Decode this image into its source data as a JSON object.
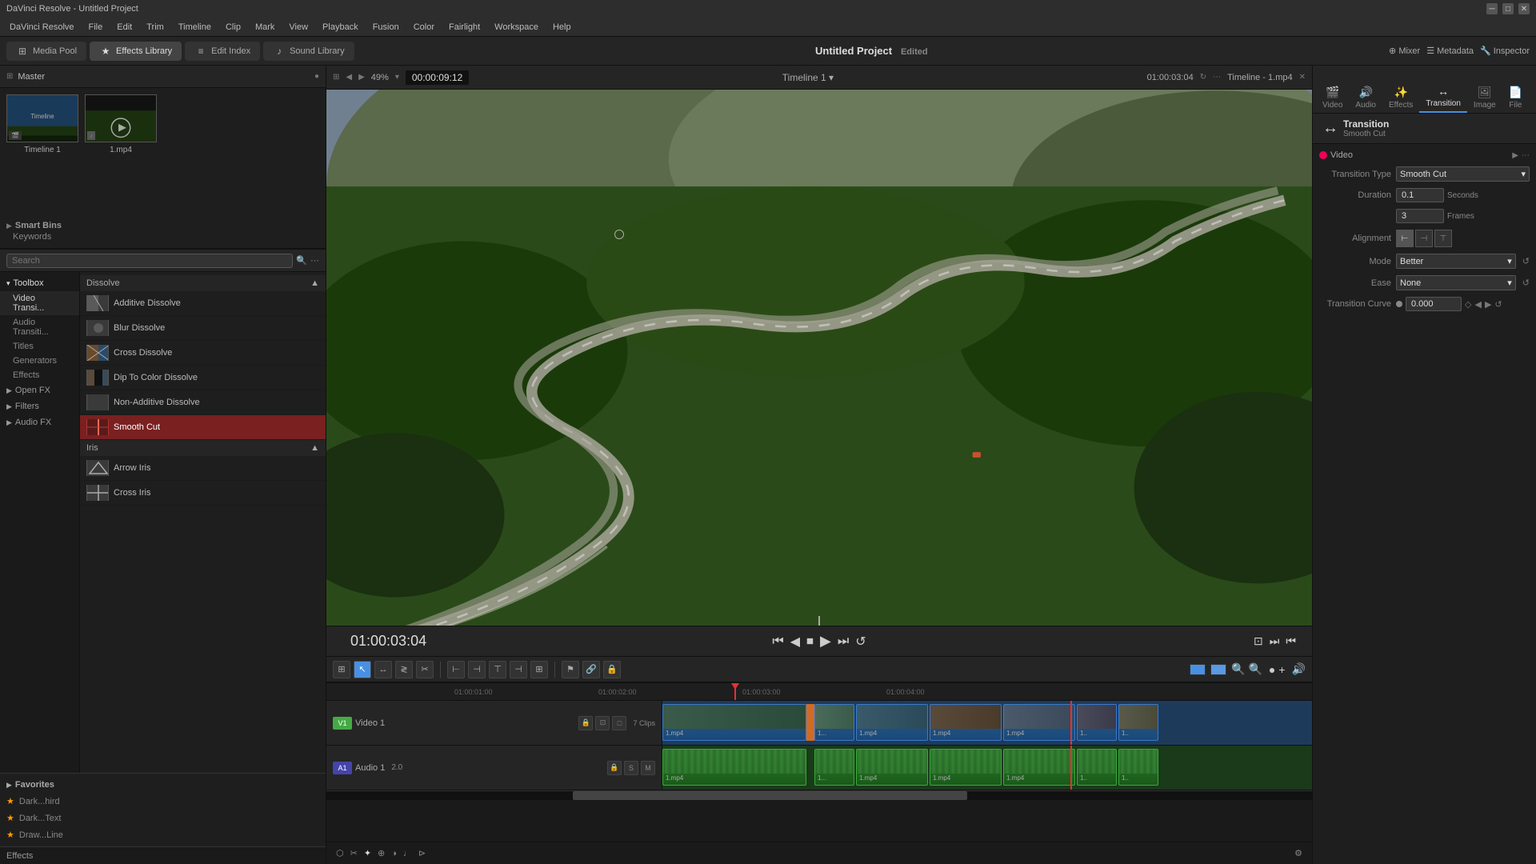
{
  "window": {
    "title": "DaVinci Resolve - Untitled Project"
  },
  "menubar": {
    "items": [
      "DaVinci Resolve",
      "File",
      "Edit",
      "Trim",
      "Timeline",
      "Clip",
      "Mark",
      "View",
      "Playback",
      "Fusion",
      "Color",
      "Fairlight",
      "Workspace",
      "Help"
    ]
  },
  "tabs": {
    "media_pool": "Media Pool",
    "effects_library": "Effects Library",
    "edit_index": "Edit Index",
    "sound_library": "Sound Library"
  },
  "project": {
    "title": "Untitled Project",
    "status": "Edited"
  },
  "media_pool": {
    "label": "Master",
    "items": [
      {
        "label": "Timeline 1",
        "type": "timeline"
      },
      {
        "label": "1.mp4",
        "type": "video"
      }
    ]
  },
  "smart_bins": {
    "label": "Smart Bins",
    "items": [
      "Keywords"
    ]
  },
  "toolbar": {
    "zoom": "49%",
    "timecode": "00:00:09:12",
    "timeline_name": "Timeline 1"
  },
  "playback": {
    "timecode": "01:00:03:04"
  },
  "top_right_timecode": "01:00:03:04",
  "effects_panel": {
    "search_placeholder": "Search",
    "categories": [
      {
        "label": "Toolbox",
        "open": true,
        "subcategories": [
          "Video Transi...",
          "Audio Transiti...",
          "Titles",
          "Generators",
          "Effects"
        ]
      },
      {
        "label": "Open FX",
        "open": false
      },
      {
        "label": "Filters",
        "open": false
      },
      {
        "label": "Audio FX",
        "open": false
      }
    ],
    "dissolve_section": "Dissolve",
    "dissolve_items": [
      {
        "label": "Additive Dissolve",
        "selected": false
      },
      {
        "label": "Blur Dissolve",
        "selected": false
      },
      {
        "label": "Cross Dissolve",
        "selected": false
      },
      {
        "label": "Dip To Color Dissolve",
        "selected": false
      },
      {
        "label": "Non-Additive Dissolve",
        "selected": false
      },
      {
        "label": "Smooth Cut",
        "selected": true
      }
    ],
    "iris_section": "Iris",
    "iris_items": [
      {
        "label": "Arrow Iris",
        "selected": false
      },
      {
        "label": "Cross Iris",
        "selected": false
      }
    ],
    "favorites_section": "Favorites",
    "favorites_items": [
      {
        "label": "Dark...hird"
      },
      {
        "label": "Dark...Text"
      },
      {
        "label": "Draw...Line"
      }
    ],
    "effects_label": "Effects"
  },
  "inspector": {
    "tabs": [
      {
        "label": "Video",
        "icon": "🎬"
      },
      {
        "label": "Audio",
        "icon": "🔊"
      },
      {
        "label": "Effects",
        "icon": "✨"
      },
      {
        "label": "Transition",
        "icon": "↔",
        "active": true
      },
      {
        "label": "Image",
        "icon": "🖼"
      },
      {
        "label": "File",
        "icon": "📄"
      }
    ],
    "section_label": "Video",
    "transition_type_label": "Transition Type",
    "transition_type_value": "Smooth Cut",
    "duration_label": "Duration",
    "duration_seconds": "0.1",
    "duration_unit_seconds": "Seconds",
    "duration_frames": "3",
    "duration_unit_frames": "Frames",
    "alignment_label": "Alignment",
    "mode_label": "Mode",
    "mode_value": "Better",
    "ease_label": "Ease",
    "ease_value": "None",
    "transition_curve_label": "Transition Curve",
    "transition_curve_value": "0.000",
    "tab_active": "Transition",
    "tab_active_subtitle": "Smooth Cut"
  },
  "timeline": {
    "tracks": [
      {
        "type": "V",
        "label": "Video 1",
        "clip_count": "7 Clips"
      },
      {
        "type": "A",
        "label": "Audio 1",
        "level": "2.0"
      }
    ],
    "clips": [
      {
        "label": "1.mp4",
        "track": "video"
      },
      {
        "label": "1...",
        "track": "video"
      },
      {
        "label": "1.mp4",
        "track": "video"
      },
      {
        "label": "1.mp4",
        "track": "video"
      },
      {
        "label": "1.mp4",
        "track": "video"
      },
      {
        "label": "1..",
        "track": "video"
      },
      {
        "label": "1..",
        "track": "video"
      }
    ]
  },
  "bottom_nav": {
    "icons": [
      "media",
      "cut",
      "edit",
      "fusion",
      "color",
      "fairlight",
      "deliver",
      "settings"
    ]
  }
}
